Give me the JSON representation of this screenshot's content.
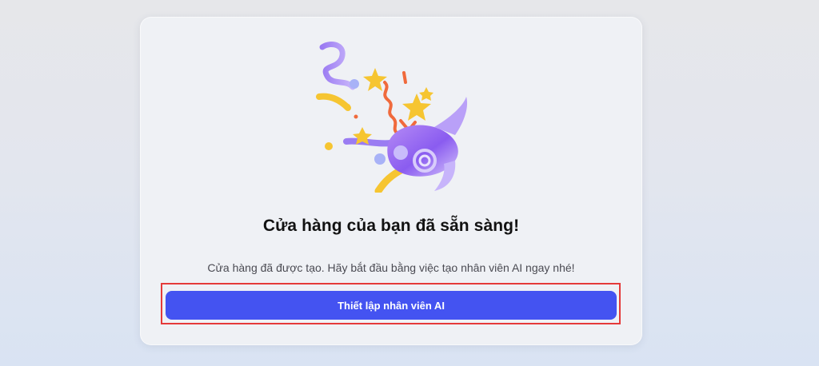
{
  "dialog": {
    "title": "Cửa hàng của bạn đã sẵn sàng!",
    "message": "Cửa hàng đã được tạo. Hãy bắt đầu bằng việc tạo nhân viên AI ngay nhé!",
    "primary_button_label": "Thiết lập nhân viên AI",
    "illustration_icon": "party-popper-icon"
  },
  "colors": {
    "primary_button": "#4453f1",
    "highlight_border": "#e53a3a",
    "card_background": "#eff1f5"
  }
}
